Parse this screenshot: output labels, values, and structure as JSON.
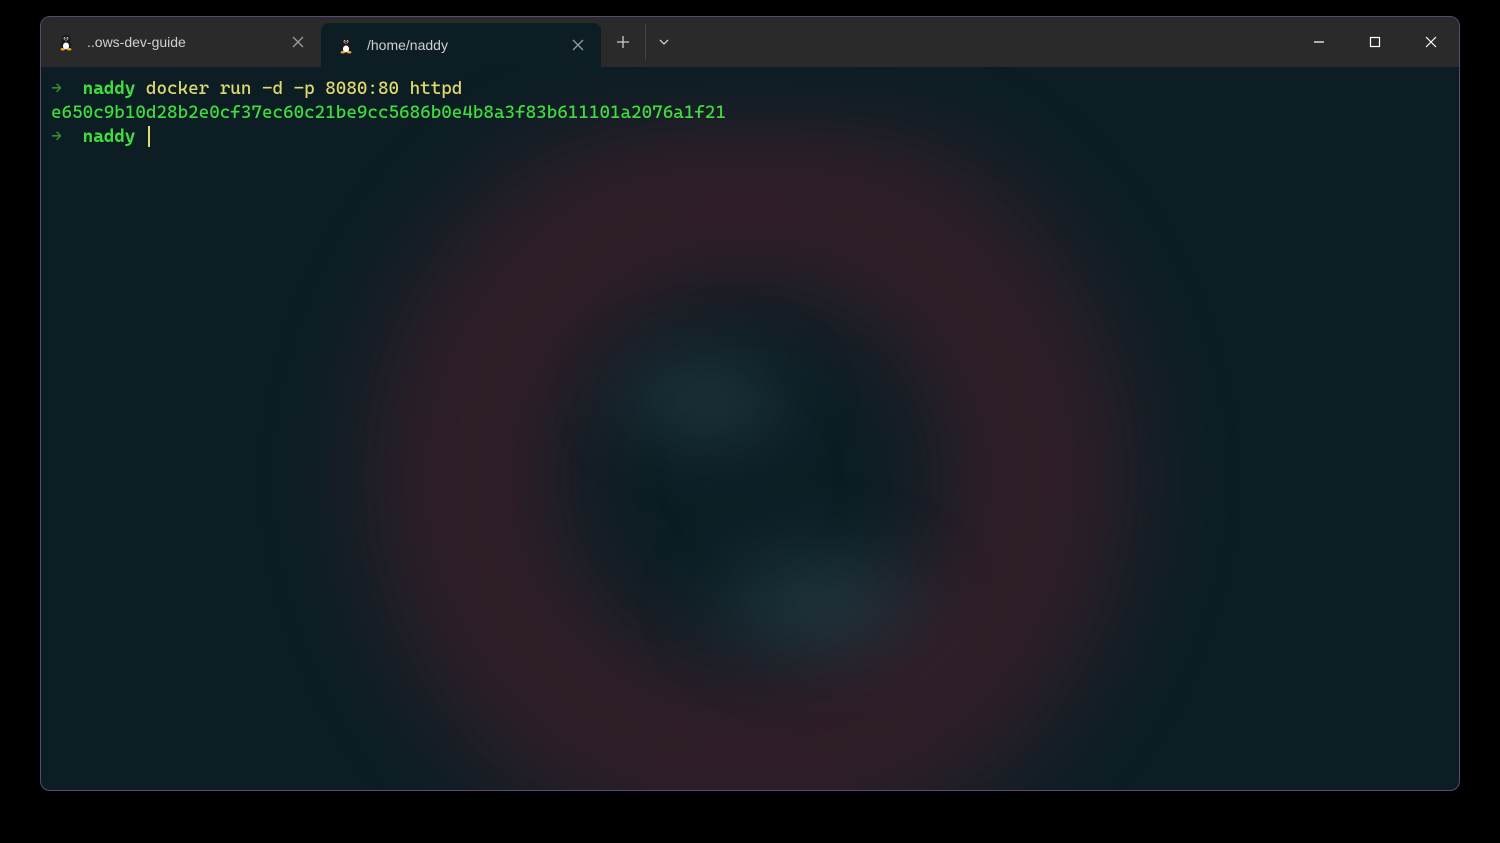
{
  "tabs": [
    {
      "title": "..ows-dev-guide",
      "active": false
    },
    {
      "title": "/home/naddy",
      "active": true
    }
  ],
  "terminal": {
    "lines": [
      {
        "type": "prompt-cmd",
        "arrow": "→",
        "host": "naddy",
        "command": "docker run -d -p 8080:80 httpd"
      },
      {
        "type": "output",
        "text": "e650c9b10d28b2e0cf37ec60c21be9cc5686b0e4b8a3f83b611101a2076a1f21"
      },
      {
        "type": "prompt",
        "arrow": "→",
        "host": "naddy"
      }
    ]
  }
}
